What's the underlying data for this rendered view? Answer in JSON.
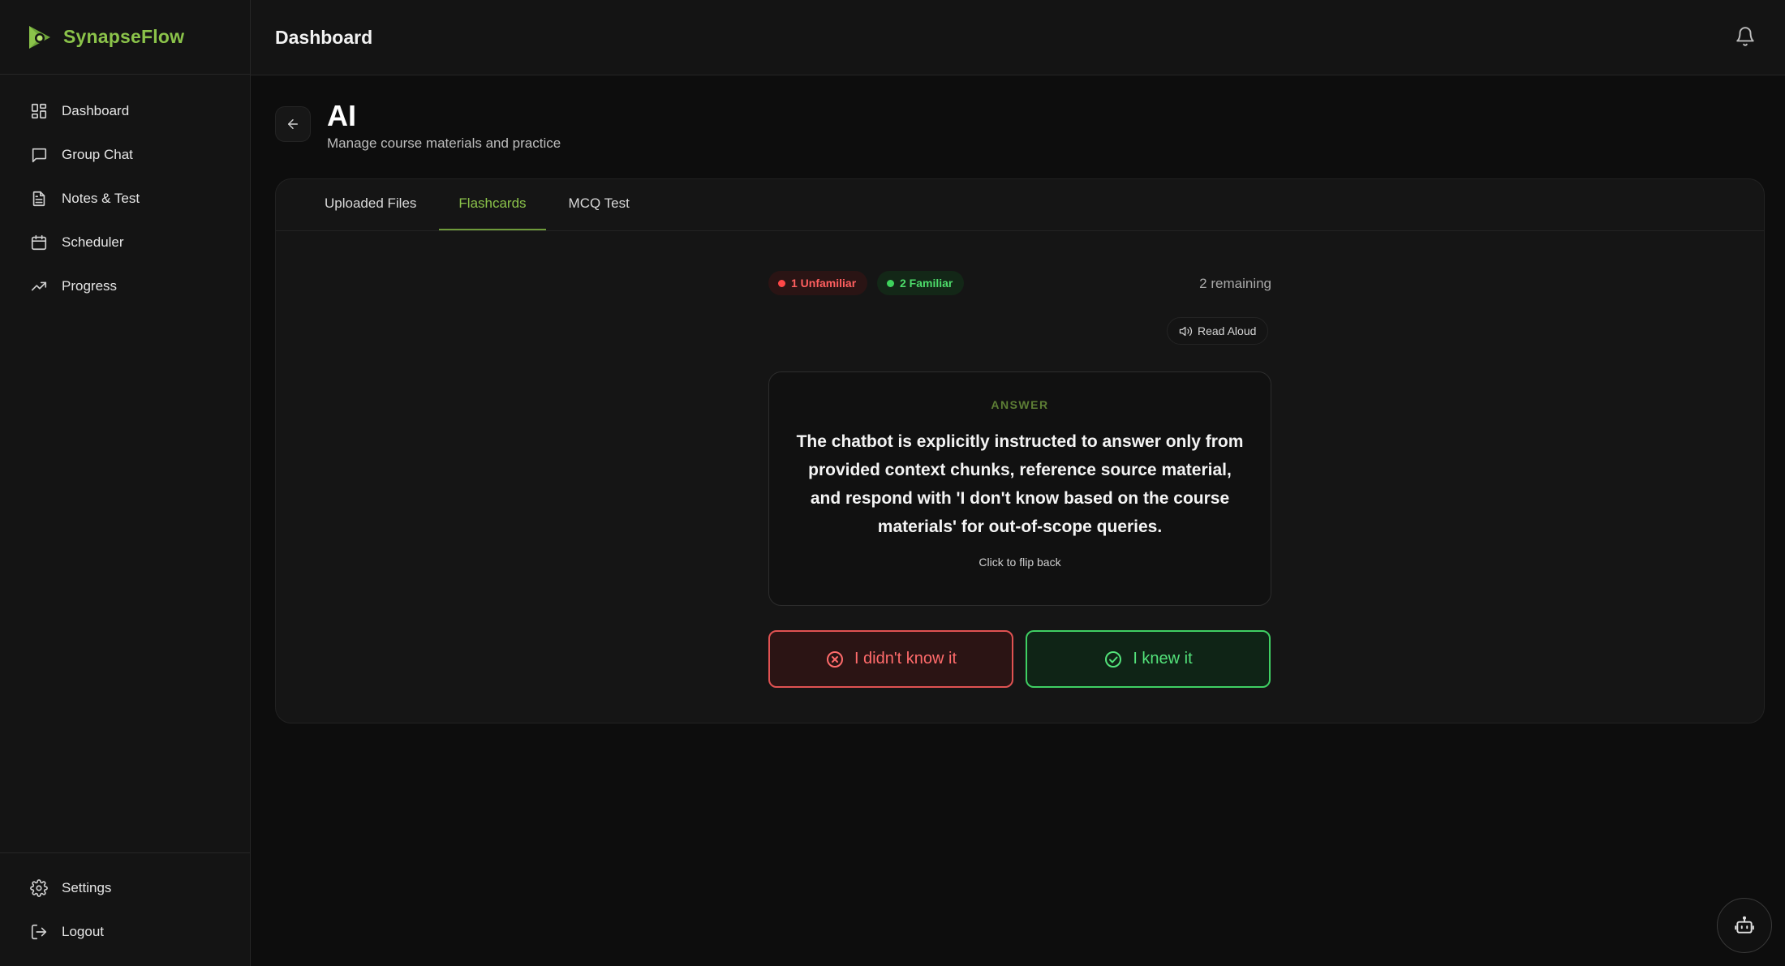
{
  "brand": {
    "name": "SynapseFlow",
    "icon": "synapseflow-logo-icon",
    "color": "#8bc34a"
  },
  "sidebar": {
    "items": [
      {
        "label": "Dashboard",
        "icon": "grid-icon"
      },
      {
        "label": "Group Chat",
        "icon": "chat-icon"
      },
      {
        "label": "Notes & Test",
        "icon": "document-icon"
      },
      {
        "label": "Scheduler",
        "icon": "calendar-icon"
      },
      {
        "label": "Progress",
        "icon": "trending-up-icon"
      }
    ],
    "bottom_items": [
      {
        "label": "Settings",
        "icon": "gear-icon"
      },
      {
        "label": "Logout",
        "icon": "logout-icon"
      }
    ]
  },
  "header": {
    "title": "Dashboard",
    "notification_icon": "bell-icon"
  },
  "page": {
    "title": "AI",
    "subtitle": "Manage course materials and practice"
  },
  "tabs": [
    {
      "label": "Uploaded Files",
      "active": false
    },
    {
      "label": "Flashcards",
      "active": true
    },
    {
      "label": "MCQ Test",
      "active": false
    }
  ],
  "stats": {
    "unfamiliar": "1 Unfamiliar",
    "familiar": "2 Familiar",
    "remaining": "2 remaining"
  },
  "read_aloud": {
    "label": "Read Aloud",
    "icon": "speaker-icon"
  },
  "flashcard": {
    "side_label": "ANSWER",
    "text": "The chatbot is explicitly instructed to answer only from provided context chunks, reference source material, and respond with 'I don't know based on the course materials' for out-of-scope queries.",
    "hint": "Click to flip back"
  },
  "actions": {
    "didnt_know": {
      "label": "I didn't know it",
      "icon": "x-circle-icon",
      "color": "#e05252"
    },
    "knew": {
      "label": "I knew it",
      "icon": "check-circle-icon",
      "color": "#3fcf63"
    }
  },
  "fab": {
    "icon": "bot-icon"
  },
  "colors": {
    "accent": "#8bc34a",
    "background": "#0d0d0d",
    "panel": "#151515"
  }
}
